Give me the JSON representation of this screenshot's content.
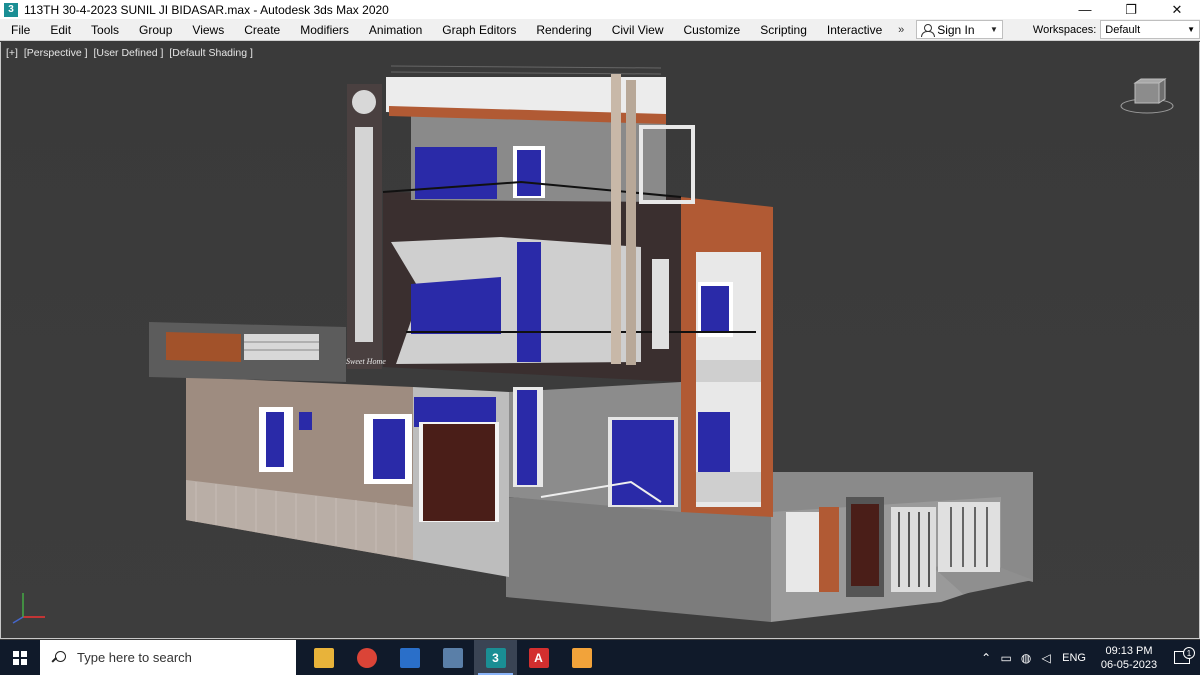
{
  "window": {
    "title": "113TH 30-4-2023 SUNIL JI BIDASAR.max - Autodesk 3ds Max 2020",
    "app_icon": "3ds-max-icon",
    "minimize": "—",
    "restore": "❐",
    "close": "✕"
  },
  "menubar": {
    "items": [
      "File",
      "Edit",
      "Tools",
      "Group",
      "Views",
      "Create",
      "Modifiers",
      "Animation",
      "Graph Editors",
      "Rendering",
      "Civil View",
      "Customize",
      "Scripting",
      "Interactive"
    ],
    "more": "»",
    "signin_label": "Sign In",
    "workspaces_label": "Workspaces:",
    "workspace_value": "Default"
  },
  "viewport": {
    "labels": [
      "[+]",
      "[Perspective ]",
      "[User Defined ]",
      "[Default Shading ]"
    ],
    "signboard_text": "Sweet Home"
  },
  "taskbar": {
    "search_placeholder": "Type here to search",
    "apps": [
      {
        "name": "file-explorer-icon",
        "color": "#e8b33a"
      },
      {
        "name": "chrome-icon",
        "color": "#db4437"
      },
      {
        "name": "photos-icon",
        "color": "#2a6fc9"
      },
      {
        "name": "network-app-icon",
        "color": "#5a7fa8"
      },
      {
        "name": "3ds-max-icon",
        "color": "#1a8e94"
      },
      {
        "name": "autocad-icon",
        "color": "#d32f2f"
      },
      {
        "name": "paint-app-icon",
        "color": "#f2a33a"
      }
    ],
    "language": "ENG",
    "time": "09:13 PM",
    "date": "06-05-2023",
    "notification_count": "1"
  }
}
